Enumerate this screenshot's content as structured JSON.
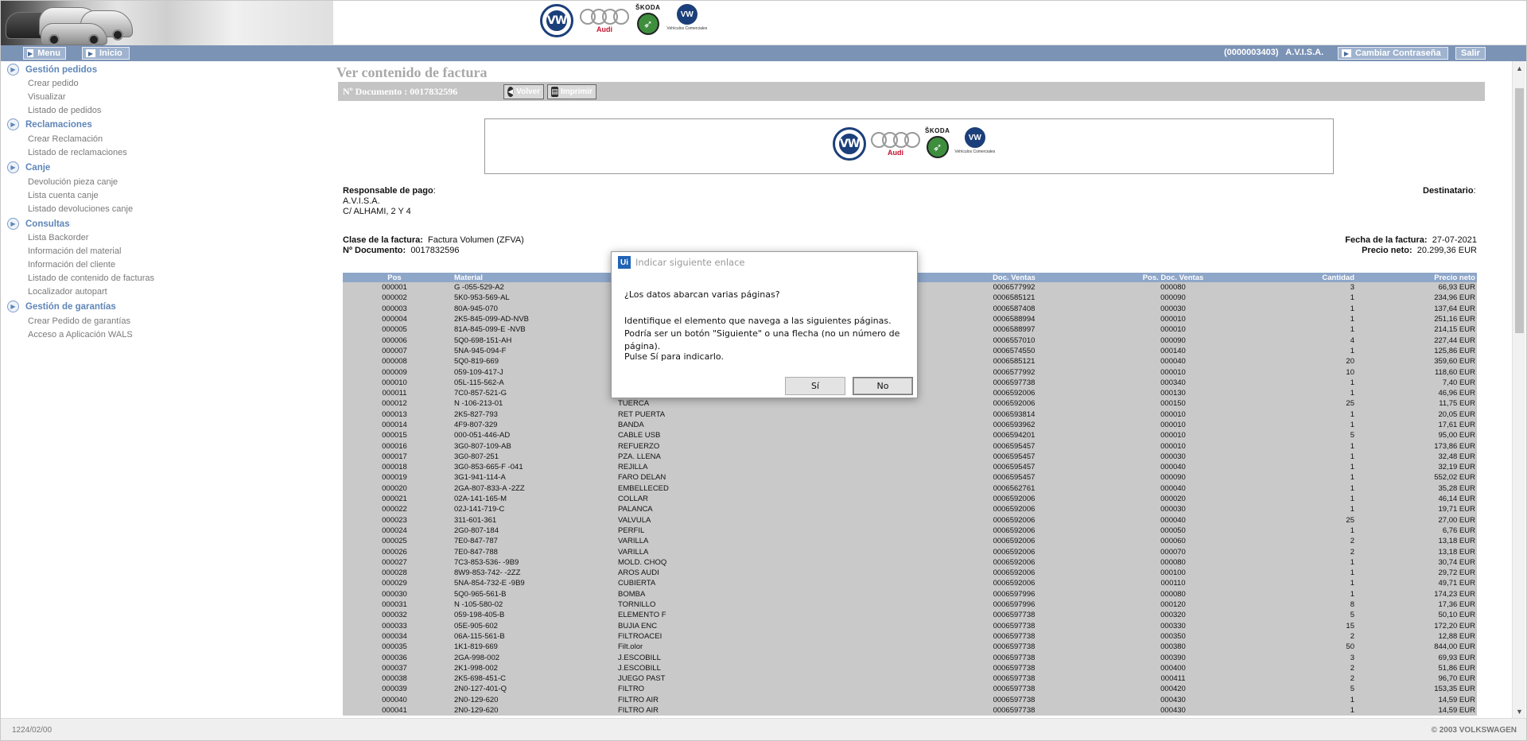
{
  "header": {
    "brands": {
      "vw": "VW",
      "audi": "Audi",
      "skoda": "ŠKODA",
      "vwc": "Vehículos Comerciales"
    }
  },
  "navbar": {
    "menu_label": "Menu",
    "inicio_label": "Inicio",
    "user_info": "(0000003403)   A.V.I.S.A.",
    "change_password_label": "Cambiar Contraseña",
    "exit_label": "Salir"
  },
  "sidebar": {
    "sections": [
      {
        "title": "Gestión pedidos",
        "links": [
          "Crear pedido",
          "Visualizar",
          "Listado de pedidos"
        ]
      },
      {
        "title": "Reclamaciones",
        "links": [
          "Crear Reclamación",
          "Listado de reclamaciones"
        ]
      },
      {
        "title": "Canje",
        "links": [
          "Devolución pieza canje",
          "Lista cuenta canje",
          "Listado devoluciones canje"
        ]
      },
      {
        "title": "Consultas",
        "links": [
          "Lista Backorder",
          "Información del material",
          "Información del cliente",
          "Listado de contenido de facturas",
          "Localizador autopart"
        ]
      },
      {
        "title": "Gestión de garantías",
        "links": [
          "Crear Pedido de garantías",
          "Acceso a Aplicación WALS"
        ]
      }
    ]
  },
  "page": {
    "title": "Ver contenido de factura",
    "doc_bar_label": "Nº Documento : 0017832596",
    "back_label": "Volver",
    "print_label": "Imprimir"
  },
  "invoice": {
    "payer_label": "Responsable de pago",
    "payer_name": "A.V.I.S.A.",
    "payer_address": "C/ ALHAMI, 2 Y 4",
    "recipient_label": "Destinatario",
    "class_label": "Clase de la factura:",
    "class_value": "Factura Volumen (ZFVA)",
    "docno_label": "Nº Documento:",
    "docno_value": "0017832596",
    "date_label": "Fecha de la factura:",
    "date_value": "27-07-2021",
    "net_label": "Precio neto:",
    "net_value": "20.299,36 EUR"
  },
  "table": {
    "columns": [
      "Pos",
      "Material",
      "",
      "Doc. Ventas",
      "Pos. Doc. Ventas",
      "Cantidad",
      "Precio neto"
    ],
    "rows": [
      [
        "000001",
        "G -055-529-A2",
        "",
        "0006577992",
        "000080",
        "3",
        "66,93 EUR"
      ],
      [
        "000002",
        "5K0-953-569-AL",
        "",
        "0006585121",
        "000090",
        "1",
        "234,96 EUR"
      ],
      [
        "000003",
        "80A-945-070",
        "",
        "0006587408",
        "000030",
        "1",
        "137,64 EUR"
      ],
      [
        "000004",
        "2K5-845-099-AD-NVB",
        "",
        "0006588994",
        "000010",
        "1",
        "251,16 EUR"
      ],
      [
        "000005",
        "81A-845-099-E -NVB",
        "",
        "0006588997",
        "000010",
        "1",
        "214,15 EUR"
      ],
      [
        "000006",
        "5Q0-698-151-AH",
        "",
        "0006557010",
        "000090",
        "4",
        "227,44 EUR"
      ],
      [
        "000007",
        "5NA-945-094-F",
        "",
        "0006574550",
        "000140",
        "1",
        "125,86 EUR"
      ],
      [
        "000008",
        "5Q0-819-669",
        "",
        "0006585121",
        "000040",
        "20",
        "359,60 EUR"
      ],
      [
        "000009",
        "059-109-417-J",
        "",
        "0006577992",
        "000010",
        "10",
        "118,60 EUR"
      ],
      [
        "000010",
        "05L-115-562-A",
        "",
        "0006597738",
        "000340",
        "1",
        "7,40 EUR"
      ],
      [
        "000011",
        "7C0-857-521-G",
        "",
        "0006592006",
        "000130",
        "1",
        "46,96 EUR"
      ],
      [
        "000012",
        "N -106-213-01",
        "TUERCA",
        "0006592006",
        "000150",
        "25",
        "11,75 EUR"
      ],
      [
        "000013",
        "2K5-827-793",
        "RET PUERTA",
        "0006593814",
        "000010",
        "1",
        "20,05 EUR"
      ],
      [
        "000014",
        "4F9-807-329",
        "BANDA",
        "0006593962",
        "000010",
        "1",
        "17,61 EUR"
      ],
      [
        "000015",
        "000-051-446-AD",
        "CABLE USB",
        "0006594201",
        "000010",
        "5",
        "95,00 EUR"
      ],
      [
        "000016",
        "3G0-807-109-AB",
        "REFUERZO",
        "0006595457",
        "000010",
        "1",
        "173,86 EUR"
      ],
      [
        "000017",
        "3G0-807-251",
        "PZA. LLENA",
        "0006595457",
        "000030",
        "1",
        "32,48 EUR"
      ],
      [
        "000018",
        "3G0-853-665-F -041",
        "REJILLA",
        "0006595457",
        "000040",
        "1",
        "32,19 EUR"
      ],
      [
        "000019",
        "3G1-941-114-A",
        "FARO DELAN",
        "0006595457",
        "000090",
        "1",
        "552,02 EUR"
      ],
      [
        "000020",
        "2GA-807-833-A -2ZZ",
        "EMBELLECED",
        "0006562761",
        "000040",
        "1",
        "35,28 EUR"
      ],
      [
        "000021",
        "02A-141-165-M",
        "COLLAR",
        "0006592006",
        "000020",
        "1",
        "46,14 EUR"
      ],
      [
        "000022",
        "02J-141-719-C",
        "PALANCA",
        "0006592006",
        "000030",
        "1",
        "19,71 EUR"
      ],
      [
        "000023",
        "311-601-361",
        "VALVULA",
        "0006592006",
        "000040",
        "25",
        "27,00 EUR"
      ],
      [
        "000024",
        "2G0-807-184",
        "PERFIL",
        "0006592006",
        "000050",
        "1",
        "6,76 EUR"
      ],
      [
        "000025",
        "7E0-847-787",
        "VARILLA",
        "0006592006",
        "000060",
        "2",
        "13,18 EUR"
      ],
      [
        "000026",
        "7E0-847-788",
        "VARILLA",
        "0006592006",
        "000070",
        "2",
        "13,18 EUR"
      ],
      [
        "000027",
        "7C3-853-536- -9B9",
        "MOLD. CHOQ",
        "0006592006",
        "000080",
        "1",
        "30,74 EUR"
      ],
      [
        "000028",
        "8W9-853-742- -2ZZ",
        "AROS AUDI",
        "0006592006",
        "000100",
        "1",
        "29,72 EUR"
      ],
      [
        "000029",
        "5NA-854-732-E -9B9",
        "CUBIERTA",
        "0006592006",
        "000110",
        "1",
        "49,71 EUR"
      ],
      [
        "000030",
        "5Q0-965-561-B",
        "BOMBA",
        "0006597996",
        "000080",
        "1",
        "174,23 EUR"
      ],
      [
        "000031",
        "N -105-580-02",
        "TORNILLO",
        "0006597996",
        "000120",
        "8",
        "17,36 EUR"
      ],
      [
        "000032",
        "059-198-405-B",
        "ELEMENTO F",
        "0006597738",
        "000320",
        "5",
        "50,10 EUR"
      ],
      [
        "000033",
        "05E-905-602",
        "BUJIA ENC",
        "0006597738",
        "000330",
        "15",
        "172,20 EUR"
      ],
      [
        "000034",
        "06A-115-561-B",
        "FILTROACEI",
        "0006597738",
        "000350",
        "2",
        "12,88 EUR"
      ],
      [
        "000035",
        "1K1-819-669",
        "Filt.olor",
        "0006597738",
        "000380",
        "50",
        "844,00 EUR"
      ],
      [
        "000036",
        "2GA-998-002",
        "J.ESCOBILL",
        "0006597738",
        "000390",
        "3",
        "69,93 EUR"
      ],
      [
        "000037",
        "2K1-998-002",
        "J.ESCOBILL",
        "0006597738",
        "000400",
        "2",
        "51,86 EUR"
      ],
      [
        "000038",
        "2K5-698-451-C",
        "JUEGO PAST",
        "0006597738",
        "000411",
        "2",
        "96,70 EUR"
      ],
      [
        "000039",
        "2N0-127-401-Q",
        "FILTRO",
        "0006597738",
        "000420",
        "5",
        "153,35 EUR"
      ],
      [
        "000040",
        "2N0-129-620",
        "FILTRO AIR",
        "0006597738",
        "000430",
        "1",
        "14,59 EUR"
      ],
      [
        "000041",
        "2N0-129-620",
        "FILTRO AIR",
        "0006597738",
        "000430",
        "1",
        "14,59 EUR"
      ]
    ]
  },
  "footer": {
    "left": "1224/02/00",
    "right": "© 2003 VOLKSWAGEN"
  },
  "dialog": {
    "logo": "Ui",
    "title": "Indicar siguiente enlace",
    "question": "¿Los datos abarcan varias páginas?",
    "body": "Identifique el elemento que navega a las siguientes páginas. Podría ser un botón \"Siguiente\" o una flecha (no un número de página).",
    "hint": "Pulse Sí para indicarlo.",
    "yes_label": "Sí",
    "no_label": "No"
  }
}
